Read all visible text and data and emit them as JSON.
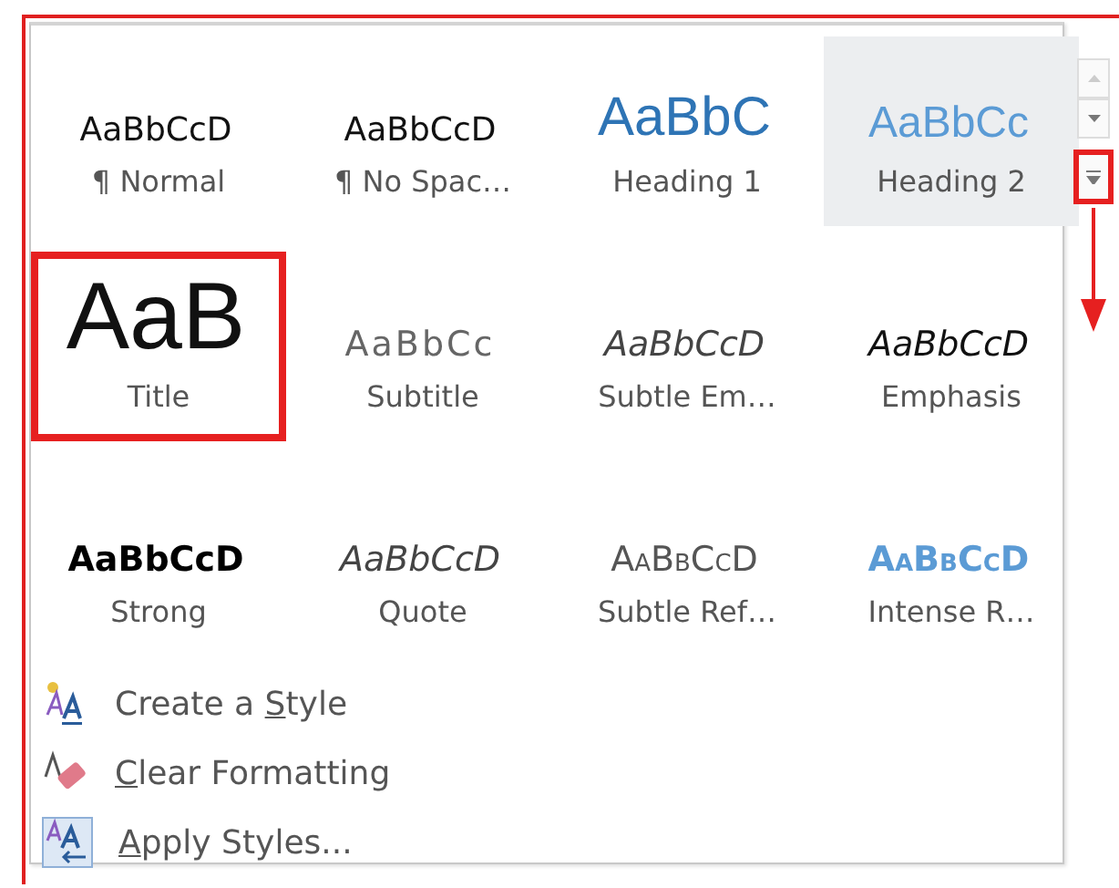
{
  "styles": [
    {
      "preview": "AaBbCcD",
      "label": "¶ Normal",
      "kind": "normal",
      "annotated": false,
      "hovered": false
    },
    {
      "preview": "AaBbCcD",
      "label": "¶ No Spac…",
      "kind": "normal",
      "annotated": false,
      "hovered": false
    },
    {
      "preview": "AaBbC",
      "label": "Heading 1",
      "kind": "heading1",
      "annotated": false,
      "hovered": false
    },
    {
      "preview": "AaBbCc",
      "label": "Heading 2",
      "kind": "heading2",
      "annotated": false,
      "hovered": true
    },
    {
      "preview": "AaB",
      "label": "Title",
      "kind": "title",
      "annotated": true,
      "hovered": false
    },
    {
      "preview": "AaBbCc",
      "label": "Subtitle",
      "kind": "subtitle",
      "annotated": false,
      "hovered": false
    },
    {
      "preview": "AaBbCcD",
      "label": "Subtle Em…",
      "kind": "subtle-emphasis",
      "annotated": false,
      "hovered": false
    },
    {
      "preview": "AaBbCcD",
      "label": "Emphasis",
      "kind": "emphasis",
      "annotated": false,
      "hovered": false
    },
    {
      "preview": "AaBbCcD",
      "label": "Strong",
      "kind": "strong",
      "annotated": false,
      "hovered": false
    },
    {
      "preview": "AaBbCcD",
      "label": "Quote",
      "kind": "quote",
      "annotated": false,
      "hovered": false
    },
    {
      "preview": "AaBbCcD",
      "label": "Subtle Ref…",
      "kind": "subtle-reference",
      "annotated": false,
      "hovered": false
    },
    {
      "preview": "AaBbCcD",
      "label": "Intense R…",
      "kind": "intense-reference",
      "annotated": false,
      "hovered": false
    }
  ],
  "commands": [
    {
      "kind": "create",
      "label": {
        "before": "Create a ",
        "key": "S",
        "after": "tyle"
      }
    },
    {
      "kind": "clear",
      "label": {
        "key": "C",
        "after": "lear Formatting"
      }
    },
    {
      "kind": "apply",
      "label": {
        "key": "A",
        "after": "pply Styles..."
      }
    }
  ],
  "more_button": {
    "annotated": true
  }
}
